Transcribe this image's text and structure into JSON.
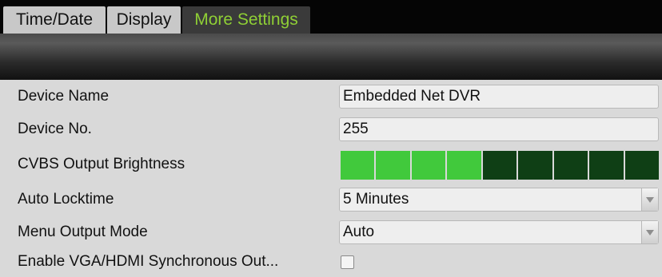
{
  "tabs": [
    {
      "label": "Time/Date",
      "active": false
    },
    {
      "label": "Display",
      "active": false
    },
    {
      "label": "More Settings",
      "active": true
    }
  ],
  "colors": {
    "active_tab_text": "#8fcf35",
    "brightness_on": "#41c93c",
    "brightness_off": "#0f3f15"
  },
  "form": {
    "device_name": {
      "label": "Device Name",
      "value": "Embedded Net DVR"
    },
    "device_no": {
      "label": "Device No.",
      "value": "255"
    },
    "cvbs_brightness": {
      "label": "CVBS Output Brightness",
      "level": 4,
      "max": 9
    },
    "auto_locktime": {
      "label": "Auto Locktime",
      "value": "5 Minutes",
      "icon": "chevron-down-icon"
    },
    "menu_output_mode": {
      "label": "Menu Output Mode",
      "value": "Auto",
      "icon": "chevron-down-icon"
    },
    "vga_hdmi_sync": {
      "label": "Enable VGA/HDMI Synchronous Out...",
      "checked": false
    }
  }
}
